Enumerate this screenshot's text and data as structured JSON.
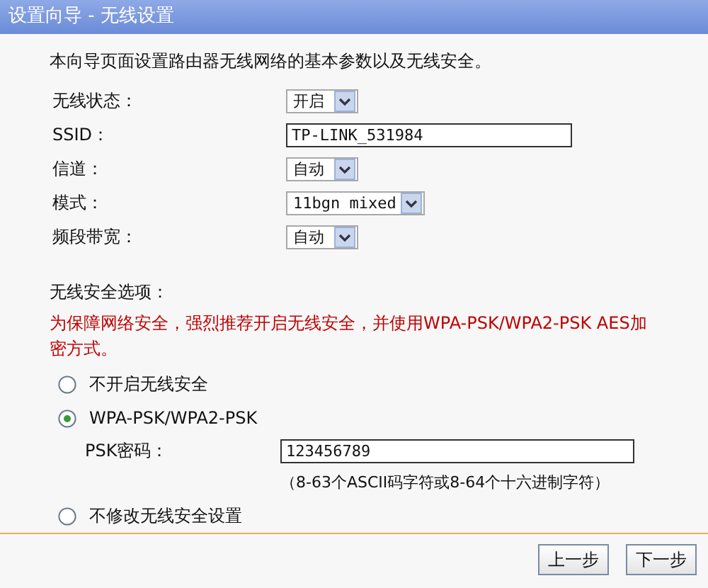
{
  "window": {
    "title": "设置向导 - 无线设置"
  },
  "intro": "本向导页面设置路由器无线网络的基本参数以及无线安全。",
  "fields": [
    {
      "label": "无线状态：",
      "kind": "select",
      "value": "开启"
    },
    {
      "label": "SSID：",
      "kind": "text",
      "value": "TP-LINK_531984"
    },
    {
      "label": "信道：",
      "kind": "select",
      "value": "自动"
    },
    {
      "label": "模式：",
      "kind": "select",
      "value": "11bgn mixed"
    },
    {
      "label": "频段带宽：",
      "kind": "select",
      "value": "自动"
    }
  ],
  "security": {
    "title": "无线安全选项：",
    "warning": "为保障网络安全，强烈推荐开启无线安全，并使用WPA-PSK/WPA2-PSK AES加密方式。",
    "options": [
      {
        "label": "不开启无线安全",
        "selected": false
      },
      {
        "label": "WPA-PSK/WPA2-PSK",
        "selected": true,
        "psk": {
          "label": "PSK密码：",
          "value": "123456789",
          "hint": "（8-63个ASCII码字符或8-64个十六进制字符）"
        }
      },
      {
        "label": "不修改无线安全设置",
        "selected": false
      }
    ]
  },
  "buttons": [
    "上一步",
    "下一步"
  ]
}
